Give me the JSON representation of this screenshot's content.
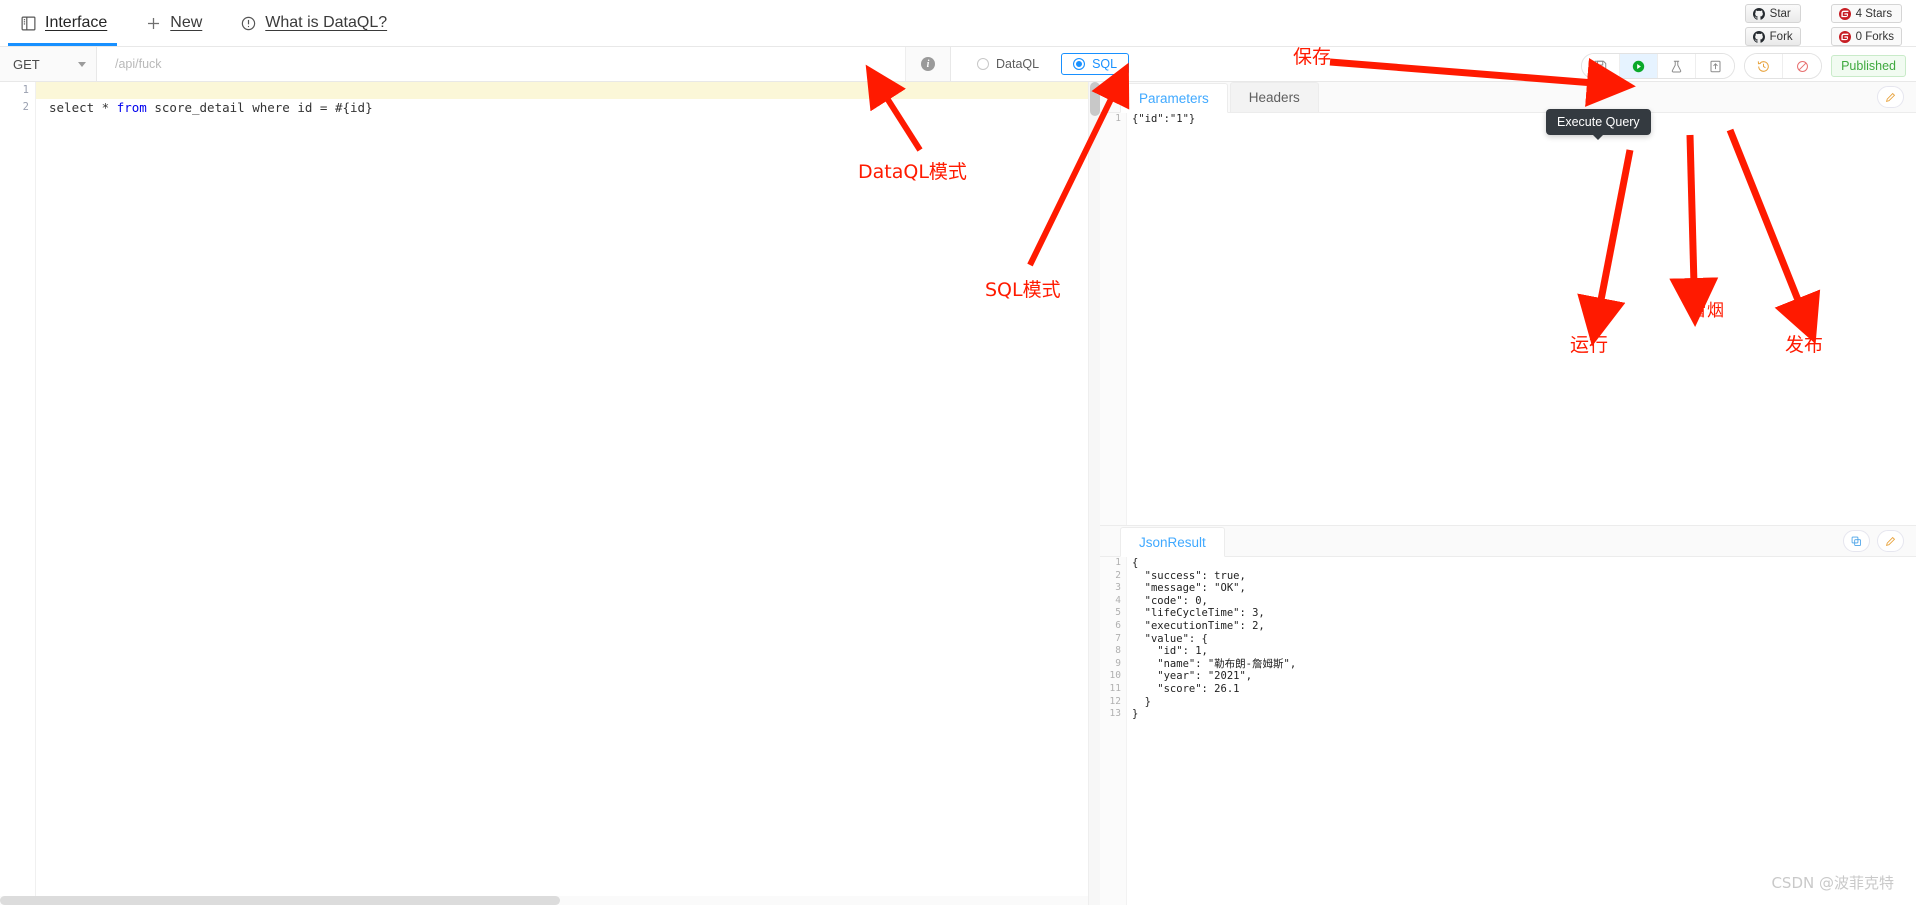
{
  "nav": {
    "tabs": [
      {
        "label": "Interface",
        "icon": "book-icon",
        "active": true
      },
      {
        "label": "New",
        "icon": "plus-icon",
        "active": false
      },
      {
        "label": "What is DataQL?",
        "icon": "info-circle-icon",
        "active": false
      }
    ]
  },
  "github": {
    "star_label": "Star",
    "fork_label": "Fork",
    "stars_count": "4 Stars",
    "forks_count": "0 Forks"
  },
  "toolbar": {
    "method": "GET",
    "url_value": "/api/fuck",
    "url_placeholder": "/api/fuck",
    "info_icon": "info-icon",
    "modes": [
      {
        "label": "DataQL",
        "checked": false
      },
      {
        "label": "SQL",
        "checked": true
      }
    ]
  },
  "actions": {
    "group_main": [
      {
        "name": "save-icon",
        "title": "Save",
        "highlight": false
      },
      {
        "name": "run-icon",
        "title": "Execute Query",
        "highlight": true
      },
      {
        "name": "flask-icon",
        "title": "Smoke Test",
        "highlight": false
      },
      {
        "name": "publish-icon",
        "title": "Publish",
        "highlight": false
      }
    ],
    "group_second": [
      {
        "name": "history-icon",
        "title": "History"
      },
      {
        "name": "disable-icon",
        "title": "Disable"
      }
    ],
    "published_label": "Published"
  },
  "tooltip": {
    "text": "Execute Query"
  },
  "editor": {
    "line_numbers": [
      "1",
      "2"
    ],
    "lines": [
      {
        "text": "",
        "highlight": true
      },
      {
        "text": "select * from score_detail where id = #{id}",
        "highlight": false
      }
    ],
    "sql_tokens": {
      "before": "select * ",
      "keyword": "from",
      "after": " score_detail where id = #{id}"
    }
  },
  "params_panel": {
    "tabs": [
      {
        "label": "Parameters",
        "active": true
      },
      {
        "label": "Headers",
        "active": false
      }
    ],
    "edit_icon": "pencil-icon",
    "line_numbers": [
      "1"
    ],
    "lines": [
      "{\"id\":\"1\"}"
    ]
  },
  "result_panel": {
    "tabs": [
      {
        "label": "JsonResult",
        "active": true
      }
    ],
    "copy_icon": "copy-icon",
    "edit_icon": "pencil-icon",
    "line_numbers": [
      "1",
      "2",
      "3",
      "4",
      "5",
      "6",
      "7",
      "8",
      "9",
      "10",
      "11",
      "12",
      "13"
    ],
    "lines": [
      "{",
      "  \"success\": true,",
      "  \"message\": \"OK\",",
      "  \"code\": 0,",
      "  \"lifeCycleTime\": 3,",
      "  \"executionTime\": 2,",
      "  \"value\": {",
      "    \"id\": 1,",
      "    \"name\": \"勒布朗-詹姆斯\",",
      "    \"year\": \"2021\",",
      "    \"score\": 26.1",
      "  }",
      "}"
    ]
  },
  "annotations": [
    {
      "id": "save",
      "text": "保存"
    },
    {
      "id": "dataql-mode",
      "text": "DataQL模式"
    },
    {
      "id": "sql-mode",
      "text": "SQL模式"
    },
    {
      "id": "run",
      "text": "运行"
    },
    {
      "id": "smoke",
      "text": "冒烟"
    },
    {
      "id": "publish",
      "text": "发布"
    }
  ],
  "watermark": {
    "text": "CSDN @波菲克特"
  },
  "colors": {
    "accent": "#1890ff",
    "annotation": "#ff1a00",
    "published": "#3fa93f",
    "run_green": "#0aa92a"
  }
}
